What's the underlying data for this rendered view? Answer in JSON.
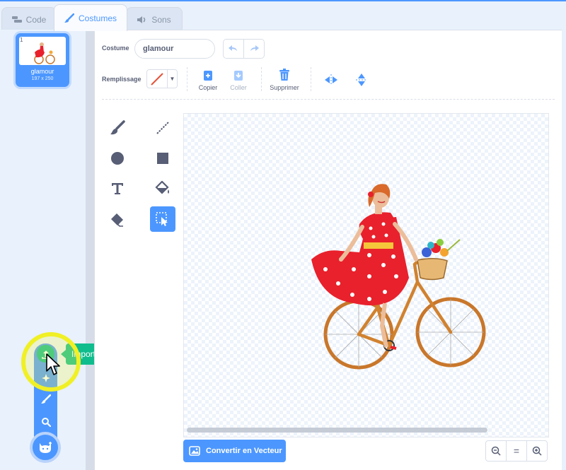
{
  "tabs": [
    {
      "label": "Code",
      "icon": "code-icon"
    },
    {
      "label": "Costumes",
      "icon": "brush-icon",
      "active": true
    },
    {
      "label": "Sons",
      "icon": "speaker-icon"
    }
  ],
  "costume_list": {
    "items": [
      {
        "number": "1",
        "name": "glamour",
        "size": "197 x 250",
        "selected": true
      }
    ]
  },
  "add_costume_menu": {
    "tooltip": "Importer un Costume",
    "items": [
      "upload-icon",
      "surprise-icon",
      "paint-icon",
      "search-icon"
    ],
    "main_icon": "cat-icon"
  },
  "editor": {
    "costume_label": "Costume",
    "costume_name": "glamour",
    "fill_label": "Remplissage",
    "actions": {
      "copy": "Copier",
      "paste": "Coller",
      "delete": "Supprimer"
    },
    "convert_button": "Convertir en Vecteur",
    "zoom": {
      "out": "zoom-out-icon",
      "reset": "=",
      "in": "zoom-in-icon"
    }
  },
  "colors": {
    "accent": "#4c97ff",
    "green": "#0fbd8c",
    "text": "#575e75",
    "highlight": "#f0f025"
  }
}
